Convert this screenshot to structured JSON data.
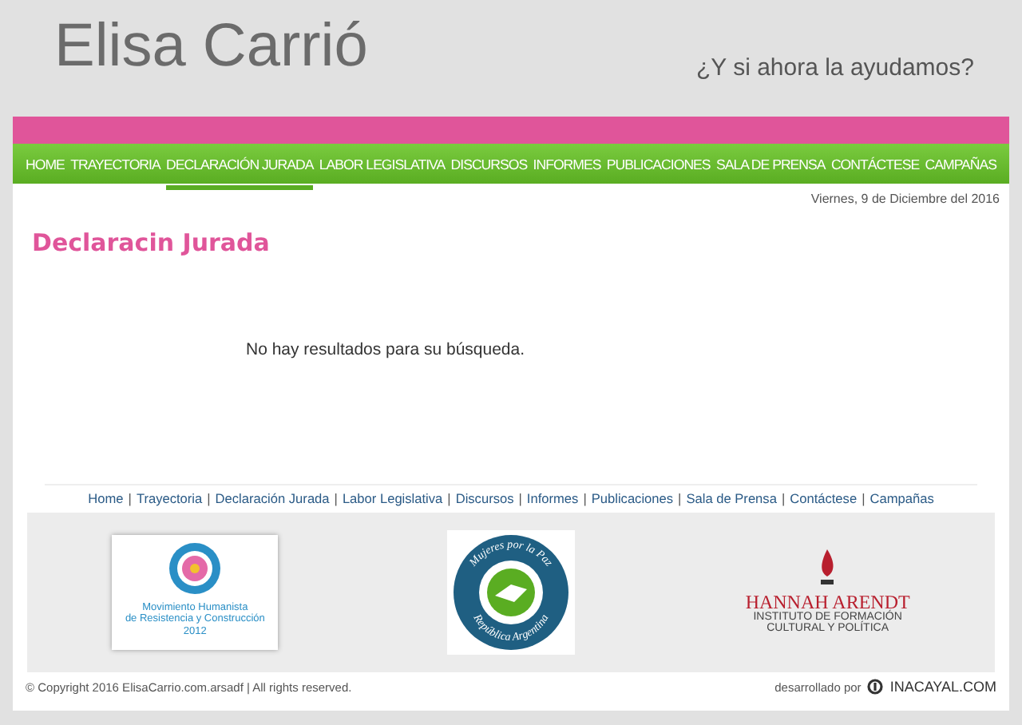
{
  "header": {
    "title": "Elisa Carrió",
    "tagline": "¿Y si ahora la ayudamos?"
  },
  "nav": [
    {
      "label": "HOME",
      "selected": false
    },
    {
      "label": "TRAYECTORIA",
      "selected": false
    },
    {
      "label": "DECLARACIÓN JURADA",
      "selected": true
    },
    {
      "label": "LABOR LEGISLATIVA",
      "selected": false
    },
    {
      "label": "DISCURSOS",
      "selected": false
    },
    {
      "label": "INFORMES",
      "selected": false
    },
    {
      "label": "PUBLICACIONES",
      "selected": false
    },
    {
      "label": "SALA DE PRENSA",
      "selected": false
    },
    {
      "label": "CONTÁCTESE",
      "selected": false
    },
    {
      "label": "CAMPAÑAS",
      "selected": false
    }
  ],
  "date": "Viernes, 9 de Diciembre del 2016",
  "heading": "Declaracin Jurada",
  "message": "No hay resultados para su búsqueda.",
  "footer_links": {
    "separator": "|",
    "items": [
      "Home",
      "Trayectoria",
      "Declaración Jurada",
      "Labor Legislativa",
      "Discursos",
      "Informes",
      "Publicaciones",
      "Sala de Prensa",
      "Contáctese",
      "Campañas"
    ]
  },
  "logos": [
    {
      "kind": "flower",
      "lines": [
        "Movimiento Humanista",
        "de Resistencia y Construcción",
        "2012"
      ]
    },
    {
      "kind": "dove",
      "lines": [
        "Mujeres por la Paz",
        "República Argentina"
      ]
    },
    {
      "kind": "flame",
      "lines": [
        "HANNAH ARENDT",
        "INSTITUTO DE FORMACIÓN",
        "CULTURAL Y POLÍTICA"
      ]
    }
  ],
  "copyright": "© Copyright 2016 ElisaCarrio.com.arsadf | All rights reserved.",
  "credit": {
    "label": "desarrollado por",
    "brand": "INACAYAL.COM"
  }
}
